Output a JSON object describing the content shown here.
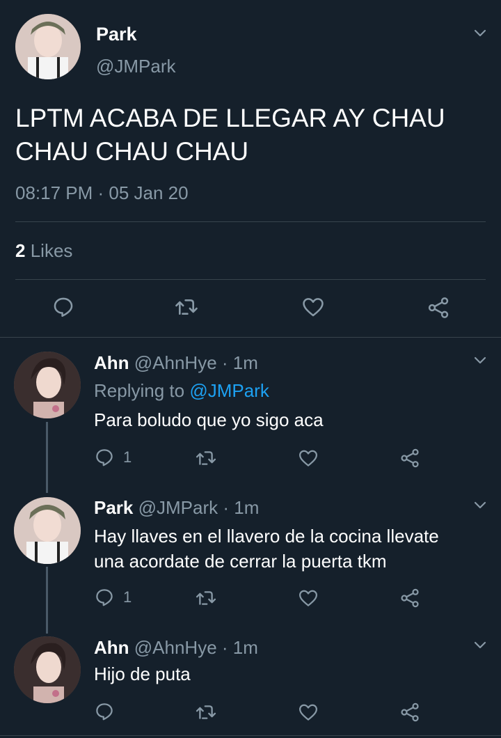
{
  "main_tweet": {
    "display_name": "Park",
    "handle": "@JMPark",
    "text": "LPTM ACABA DE LLEGAR AY CHAU CHAU CHAU CHAU",
    "timestamp": "08:17 PM · 05 Jan 20",
    "likes_count": "2",
    "likes_label": "Likes"
  },
  "replies": [
    {
      "display_name": "Ahn",
      "handle": "@AhnHye",
      "time": "· 1m",
      "replying_prefix": "Replying to",
      "replying_to": "@JMPark",
      "text": "Para boludo que yo sigo aca",
      "reply_count": "1"
    },
    {
      "display_name": "Park",
      "handle": "@JMPark",
      "time": "· 1m",
      "text_line1": "Hay llaves en el llavero de la cocina llevate",
      "text_line2": "una acordate de cerrar la puerta tkm",
      "reply_count": "1"
    },
    {
      "display_name": "Ahn",
      "handle": "@AhnHye",
      "time": "· 1m",
      "text": "Hijo de puta",
      "reply_count": ""
    }
  ],
  "icons": [
    "chevron-down-icon",
    "reply-icon",
    "retweet-icon",
    "like-icon",
    "share-icon"
  ],
  "colors": {
    "background": "#15202b",
    "muted": "#8899a6",
    "link": "#1da1f2",
    "divider": "#38444d"
  }
}
